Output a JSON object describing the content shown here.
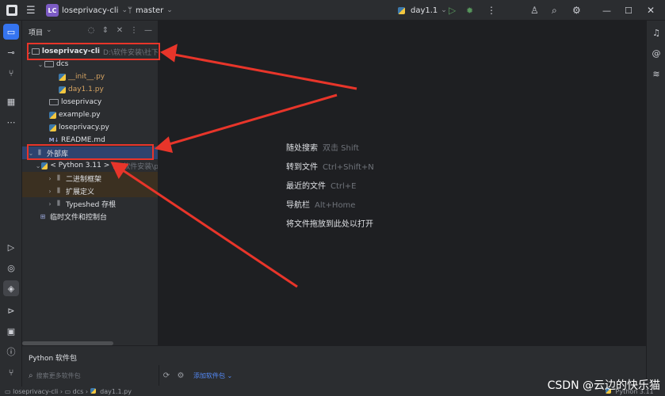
{
  "titlebar": {
    "menu_icon": "hamburger-icon",
    "project_badge": "LC",
    "project_name": "loseprivacy-cli",
    "branch_name": "master",
    "run_config": "day1.1"
  },
  "project_panel": {
    "title": "项目",
    "tree": [
      {
        "label": "loseprivacy-cli",
        "hint": "D:\\软件安装\\社下",
        "type": "folder",
        "expanded": true
      },
      {
        "label": "dcs",
        "type": "package",
        "expanded": true
      },
      {
        "label": "__init__.py",
        "type": "py"
      },
      {
        "label": "day1.1.py",
        "type": "py"
      },
      {
        "label": "loseprivacy",
        "type": "folder"
      },
      {
        "label": "example.py",
        "type": "py"
      },
      {
        "label": "loseprivacy.py",
        "type": "py"
      },
      {
        "label": "README.md",
        "type": "md"
      },
      {
        "label": "外部库",
        "type": "lib",
        "expanded": true
      },
      {
        "label": "< Python 3.11 >",
        "hint": "D:\\软件安装\\p",
        "type": "py-sdk",
        "expanded": true
      },
      {
        "label": "二进制框架",
        "type": "lib"
      },
      {
        "label": "扩展定义",
        "type": "lib"
      },
      {
        "label": "Typeshed 存根",
        "type": "lib"
      },
      {
        "label": "临时文件和控制台",
        "type": "scratch"
      }
    ]
  },
  "editor": {
    "tips": [
      {
        "label": "随处搜索",
        "shortcut": "双击 Shift"
      },
      {
        "label": "转到文件",
        "shortcut": "Ctrl+Shift+N"
      },
      {
        "label": "最近的文件",
        "shortcut": "Ctrl+E"
      },
      {
        "label": "导航栏",
        "shortcut": "Alt+Home"
      },
      {
        "label": "将文件拖放到此处以打开",
        "shortcut": ""
      }
    ]
  },
  "python_packages": {
    "title": "Python 软件包",
    "search_placeholder": "搜索更多软件包",
    "add_label": "添加软件包"
  },
  "statusbar": {
    "breadcrumb": [
      "loseprivacy-cli",
      "dcs",
      "day1.1.py"
    ],
    "interpreter": "Python 3.11"
  },
  "watermark": "CSDN @云边的快乐猫",
  "colors": {
    "accent": "#3574f0",
    "annotation": "#e8352a",
    "selection": "#2e436e"
  }
}
